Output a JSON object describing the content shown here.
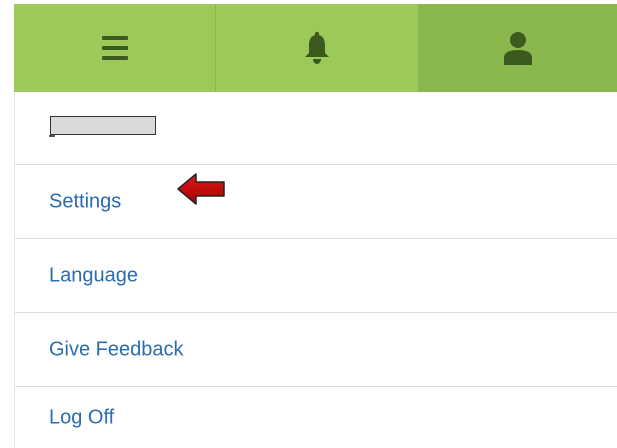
{
  "topbar": {
    "tabs": [
      {
        "icon": "hamburger-menu-icon"
      },
      {
        "icon": "bell-icon"
      },
      {
        "icon": "user-icon"
      }
    ],
    "bg_color": "#9dc95a",
    "active_tab_color": "#8ab84e",
    "icon_color": "#3d5a1e"
  },
  "menu": {
    "user_name_redacted": true,
    "items": [
      {
        "label": "Settings"
      },
      {
        "label": "Language"
      },
      {
        "label": "Give Feedback"
      },
      {
        "label": "Log Off"
      }
    ],
    "link_color": "#2b6cb0"
  },
  "annotation": {
    "icon": "red-arrow-icon",
    "color": "#cc0000"
  }
}
